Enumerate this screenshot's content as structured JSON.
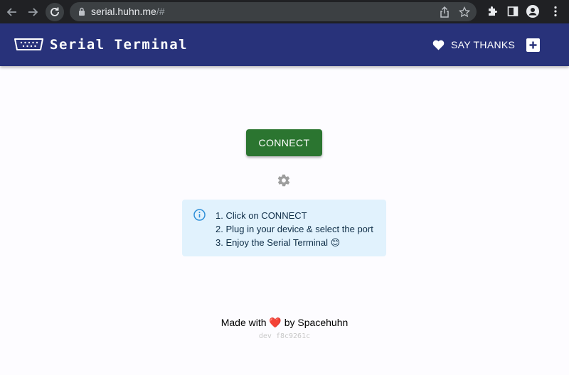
{
  "browser": {
    "url_host": "serial.huhn.me",
    "url_path": "/#",
    "icons": [
      "back-arrow-icon",
      "forward-arrow-icon",
      "reload-icon",
      "lock-icon",
      "share-icon",
      "star-icon",
      "extensions-icon",
      "side-panel-icon",
      "profile-icon",
      "menu-icon"
    ]
  },
  "header": {
    "title": "Serial Terminal",
    "thanks_label": "SAY THANKS",
    "background": "#28327a"
  },
  "main": {
    "connect_label": "CONNECT",
    "connect_color": "#2b7530",
    "steps": [
      "1. Click on CONNECT",
      "2. Plug in your device & select the port",
      "3. Enjoy the Serial Terminal 😊"
    ]
  },
  "footer": {
    "made_prefix": "Made with",
    "heart": "❤️",
    "made_suffix": "by Spacehuhn",
    "version": "dev f8c9261c"
  }
}
